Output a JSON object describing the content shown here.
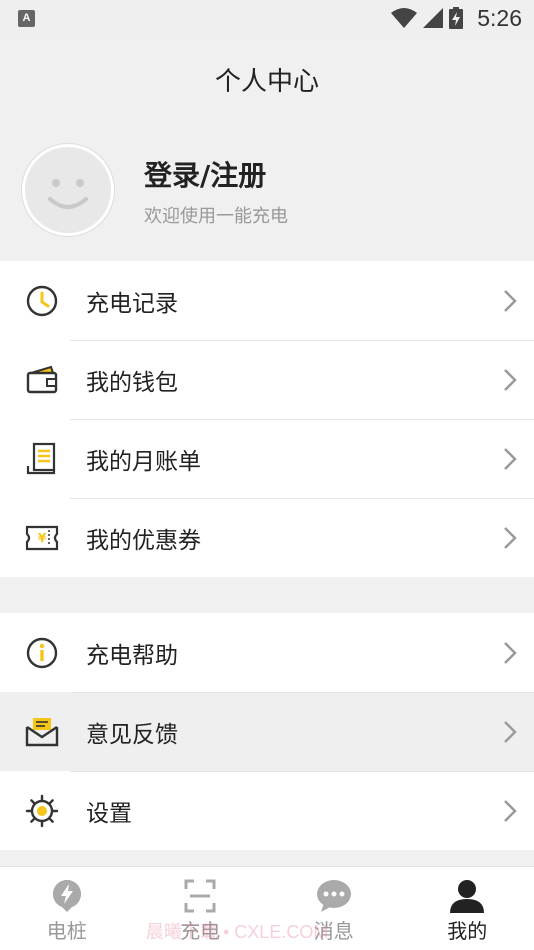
{
  "status_bar": {
    "time": "5:26",
    "app_icon_letter": "A"
  },
  "header": {
    "title": "个人中心"
  },
  "profile": {
    "login_label": "登录/注册",
    "welcome_text": "欢迎使用一能充电"
  },
  "menu_group_1": [
    {
      "label": "充电记录",
      "icon": "clock-icon"
    },
    {
      "label": "我的钱包",
      "icon": "wallet-icon"
    },
    {
      "label": "我的月账单",
      "icon": "bill-icon"
    },
    {
      "label": "我的优惠券",
      "icon": "coupon-icon"
    }
  ],
  "menu_group_2": [
    {
      "label": "充电帮助",
      "icon": "info-icon"
    },
    {
      "label": "意见反馈",
      "icon": "feedback-mail-icon"
    },
    {
      "label": "设置",
      "icon": "settings-gear-icon"
    }
  ],
  "bottom_nav": [
    {
      "label": "电桩",
      "icon": "charging-pile-icon"
    },
    {
      "label": "充电",
      "icon": "scan-icon"
    },
    {
      "label": "消息",
      "icon": "message-icon"
    },
    {
      "label": "我的",
      "icon": "user-icon",
      "selected": true
    }
  ],
  "watermark": "晨曦下载 • CXLE.COM",
  "colors": {
    "accent": "#f5c518",
    "icon_stroke": "#333333",
    "chevron": "#9a9a9a"
  }
}
